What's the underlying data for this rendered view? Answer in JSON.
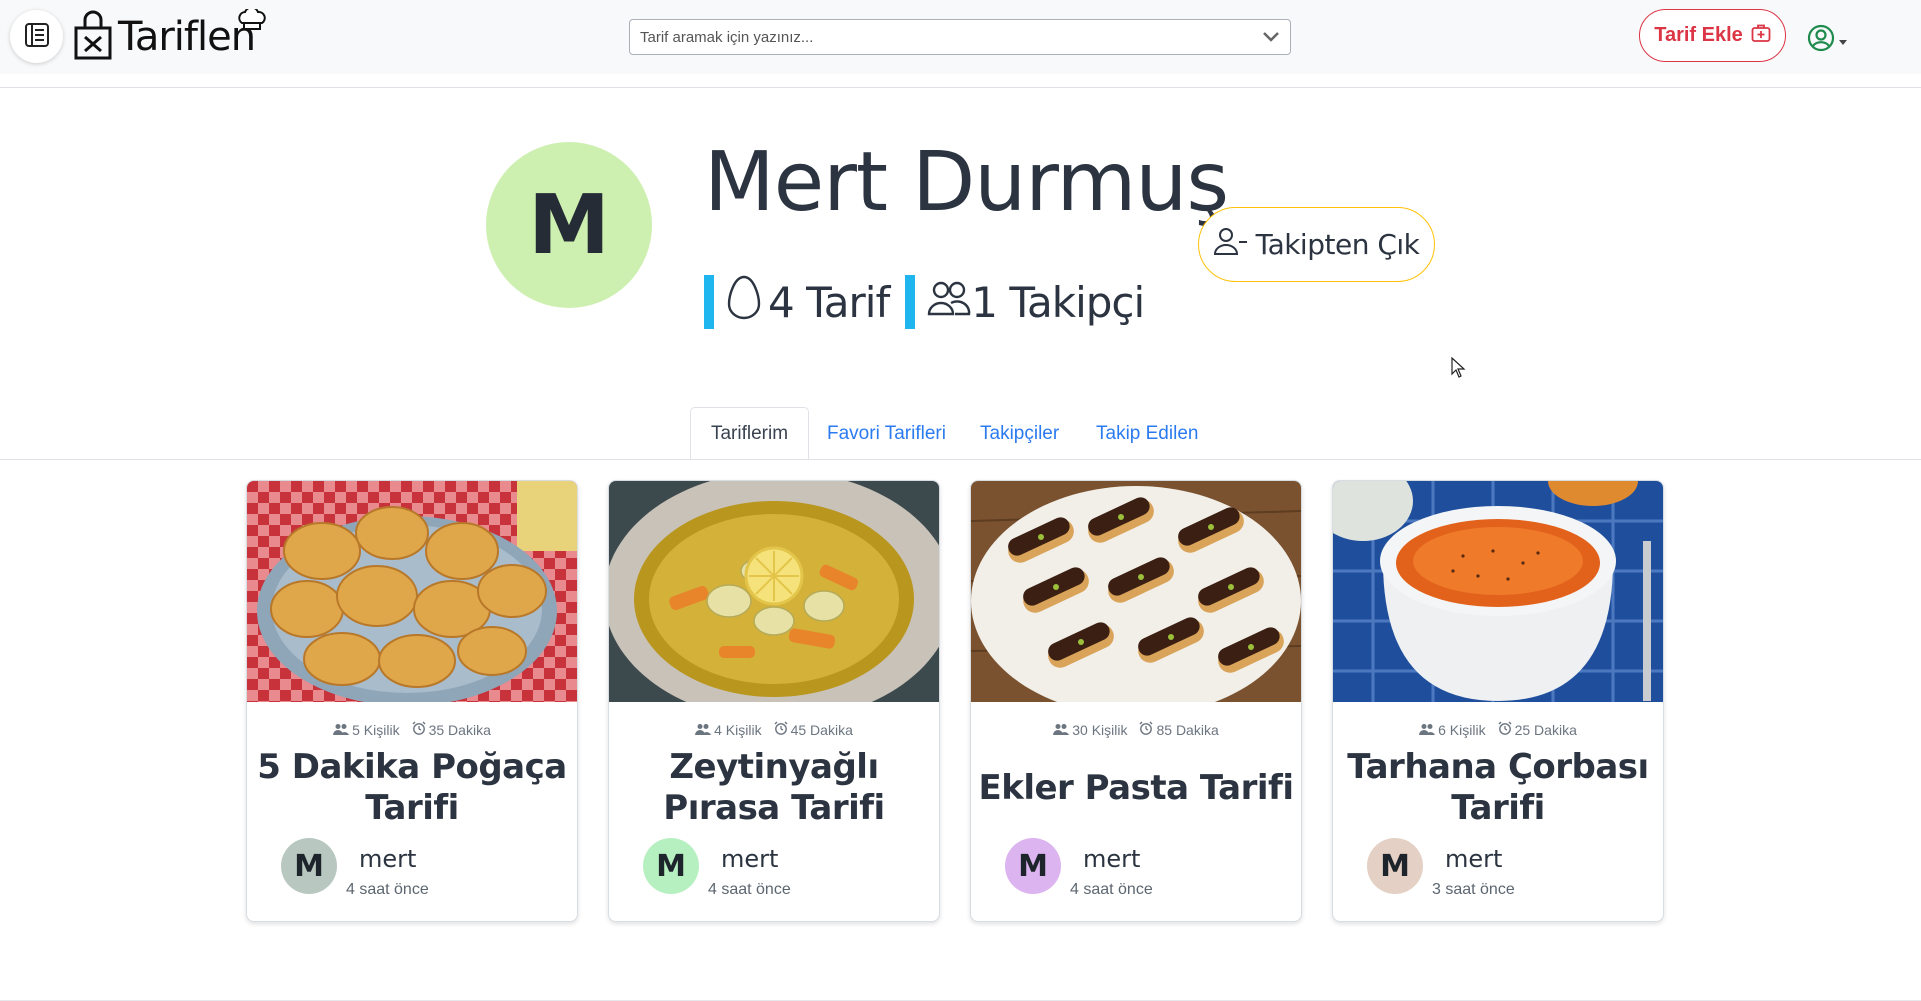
{
  "header": {
    "logo_text": "Tariflen",
    "search_placeholder": "Tarif aramak için yazınız...",
    "add_recipe_label": "Tarif Ekle"
  },
  "profile": {
    "initial": "M",
    "avatar_color": "#cdf0b0",
    "name": "Mert Durmuş",
    "recipe_count_label": "4 Tarif",
    "follower_count_label": "1 Takipçi",
    "unfollow_label": "Takipten Çık"
  },
  "tabs": [
    {
      "label": "Tariflerim",
      "active": true
    },
    {
      "label": "Favori Tarifleri",
      "active": false
    },
    {
      "label": "Takipçiler",
      "active": false
    },
    {
      "label": "Takip Edilen",
      "active": false
    }
  ],
  "recipes": [
    {
      "servings": "5 Kişilik",
      "duration": "35 Dakika",
      "title": "5 Dakika Poğaça Tarifi",
      "author": "mert",
      "author_initial": "M",
      "author_color": "#b8c8c0",
      "time_ago": "4 saat önce",
      "image": "pogaca"
    },
    {
      "servings": "4 Kişilik",
      "duration": "45 Dakika",
      "title": "Zeytinyağlı Pırasa Tarifi",
      "author": "mert",
      "author_initial": "M",
      "author_color": "#b6f0c0",
      "time_ago": "4 saat önce",
      "image": "pirasa"
    },
    {
      "servings": "30 Kişilik",
      "duration": "85 Dakika",
      "title": "Ekler Pasta Tarifi",
      "author": "mert",
      "author_initial": "M",
      "author_color": "#dcb4f0",
      "time_ago": "4 saat önce",
      "image": "ekler"
    },
    {
      "servings": "6 Kişilik",
      "duration": "25 Dakika",
      "title": "Tarhana Çorbası Tarifi",
      "author": "mert",
      "author_initial": "M",
      "author_color": "#e4d0c4",
      "time_ago": "3 saat önce",
      "image": "tarhana"
    }
  ],
  "colors": {
    "accent_blue": "#1fb6ef",
    "danger": "#dc3545",
    "warning": "#ffc107",
    "link": "#2b7bf0"
  }
}
